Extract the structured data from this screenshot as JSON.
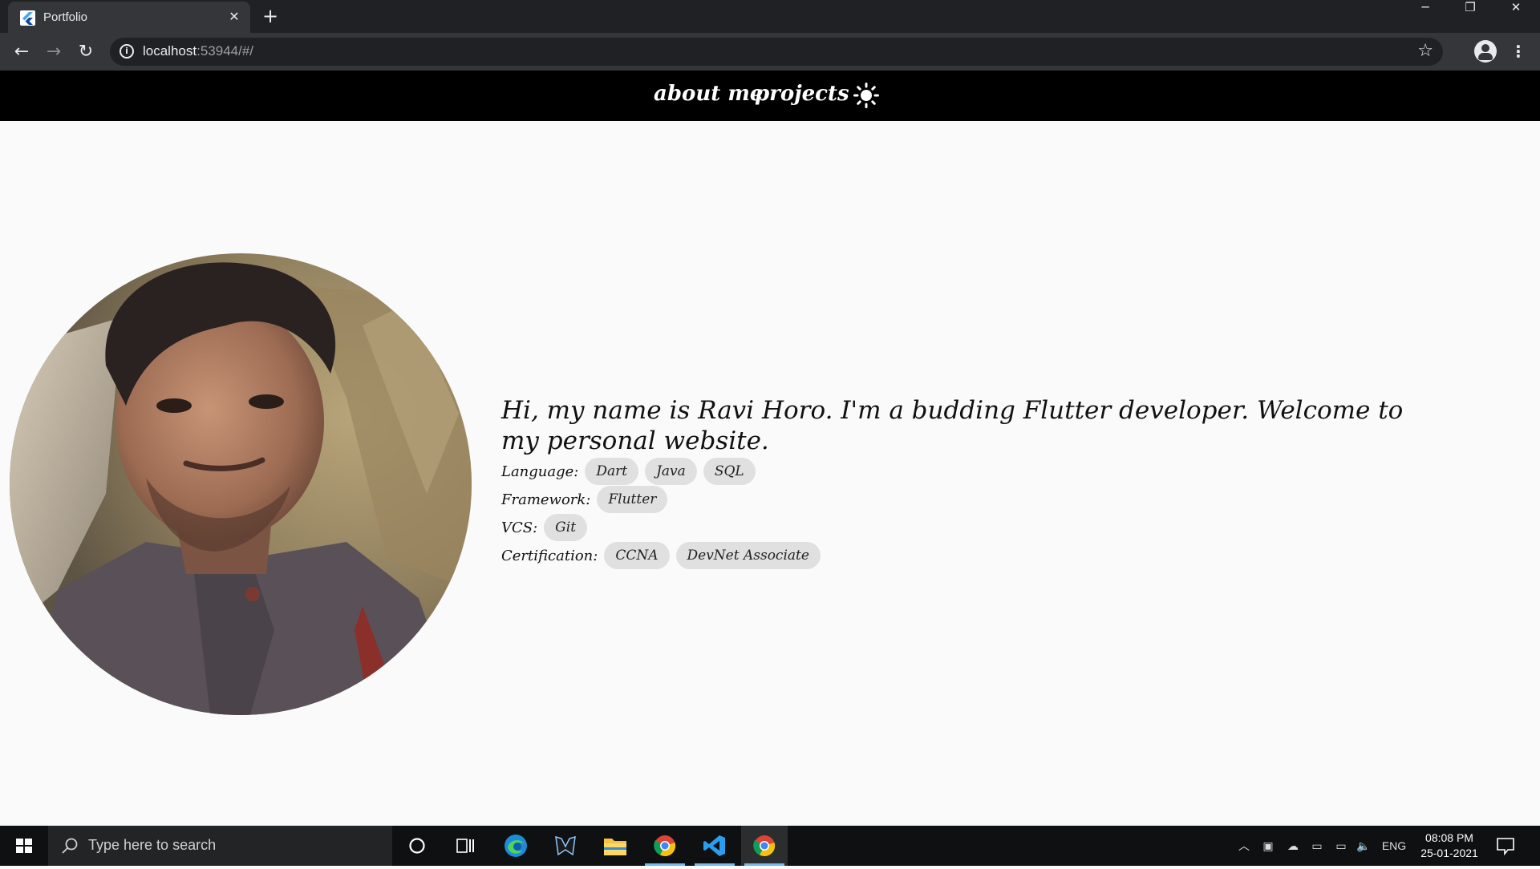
{
  "browser": {
    "tab_title": "Portfolio",
    "tab_close": "✕",
    "new_tab": "+",
    "url_host": "localhost",
    "url_rest": ":53944/#/",
    "window_controls": {
      "minimize": "─",
      "restore": "❐",
      "close": "✕"
    }
  },
  "site": {
    "nav": {
      "about": "about me",
      "projects": "projects"
    },
    "theme_toggle_icon": "sun-icon",
    "intro": "Hi, my name is Ravi Horo. I'm a budding Flutter developer. Welcome to my personal website.",
    "skills": [
      {
        "label": "Language:",
        "chips": [
          "Dart",
          "Java",
          "SQL"
        ]
      },
      {
        "label": "Framework:",
        "chips": [
          "Flutter"
        ]
      },
      {
        "label": "VCS:",
        "chips": [
          "Git"
        ]
      },
      {
        "label": "Certification:",
        "chips": [
          "CCNA",
          "DevNet Associate"
        ]
      }
    ]
  },
  "taskbar": {
    "search_placeholder": "Type here to search",
    "language": "ENG",
    "time": "08:08 PM",
    "date": "25-01-2021"
  },
  "colors": {
    "nav_bg": "#000000",
    "page_bg": "#fafafa",
    "chip_bg": "#e0e0e0",
    "browser_dark": "#202124"
  }
}
